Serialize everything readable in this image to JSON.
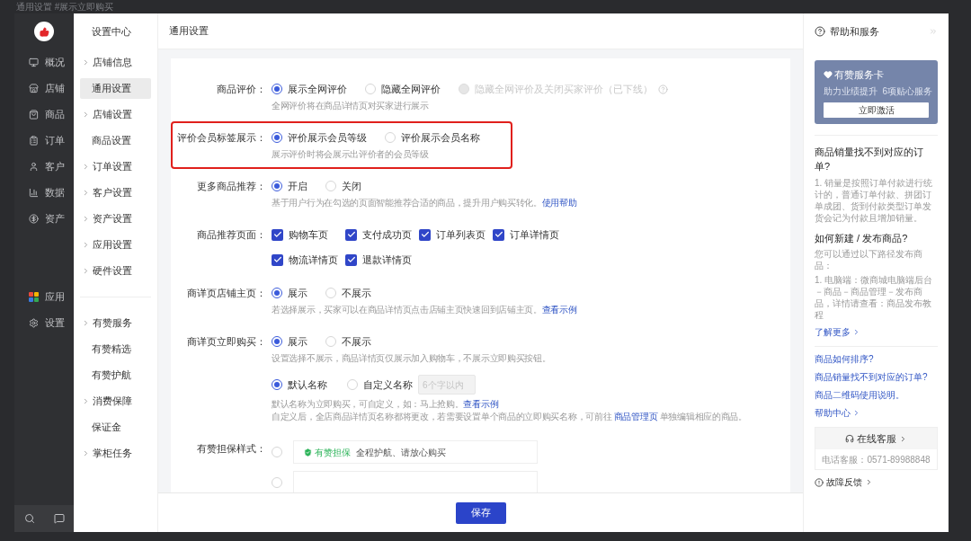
{
  "caption": "通用设置 #展示立即购买",
  "nav": [
    {
      "label": "概况"
    },
    {
      "label": "店铺"
    },
    {
      "label": "商品"
    },
    {
      "label": "订单"
    },
    {
      "label": "客户"
    },
    {
      "label": "数据"
    },
    {
      "label": "资产"
    }
  ],
  "nav_extra": [
    {
      "label": "应用"
    },
    {
      "label": "设置"
    }
  ],
  "subnav": {
    "title": "设置中心",
    "sections": [
      [
        {
          "label": "店铺信息",
          "kind": "folder",
          "selected": false
        },
        {
          "label": "通用设置",
          "kind": "page",
          "selected": true
        },
        {
          "label": "店铺设置",
          "kind": "folder",
          "selected": false
        },
        {
          "label": "商品设置",
          "kind": "page",
          "selected": false
        },
        {
          "label": "订单设置",
          "kind": "folder",
          "selected": false
        },
        {
          "label": "客户设置",
          "kind": "folder",
          "selected": false
        },
        {
          "label": "资产设置",
          "kind": "folder",
          "selected": false
        },
        {
          "label": "应用设置",
          "kind": "folder",
          "selected": false
        },
        {
          "label": "硬件设置",
          "kind": "folder",
          "selected": false
        }
      ],
      [
        {
          "label": "有赞服务",
          "kind": "folder",
          "selected": false
        },
        {
          "label": "有赞精选",
          "kind": "page",
          "selected": false
        },
        {
          "label": "有赞护航",
          "kind": "page",
          "selected": false
        },
        {
          "label": "消费保障",
          "kind": "folder",
          "selected": false
        },
        {
          "label": "保证金",
          "kind": "page",
          "selected": false
        },
        {
          "label": "掌柜任务",
          "kind": "folder",
          "selected": false
        }
      ]
    ]
  },
  "header": {
    "title": "通用设置"
  },
  "form": [
    {
      "label": "商品评价：",
      "kind": "radio",
      "highlighted": false,
      "options": [
        {
          "label": "展示全网评价",
          "selected": true,
          "disabled": false
        },
        {
          "label": "隐藏全网评价",
          "selected": false,
          "disabled": false
        },
        {
          "label": "隐藏全网评价及关闭买家评价（已下线）",
          "selected": false,
          "disabled": true
        }
      ],
      "hint": [
        {
          "text": "全网评价将在商品详情页对买家进行展示",
          "link": false
        }
      ]
    },
    {
      "label": "评价会员标签展示：",
      "kind": "radio",
      "highlighted": true,
      "options": [
        {
          "label": "评价展示会员等级",
          "selected": true,
          "disabled": false
        },
        {
          "label": "评价展示会员名称",
          "selected": false,
          "disabled": false
        }
      ],
      "hint": [
        {
          "text": "展示评价时将会展示出评价者的会员等级",
          "link": false
        }
      ]
    },
    {
      "label": "更多商品推荐：",
      "kind": "radio",
      "highlighted": false,
      "options": [
        {
          "label": "开启",
          "selected": true,
          "disabled": false
        },
        {
          "label": "关闭",
          "selected": false,
          "disabled": false
        }
      ],
      "hint": [
        {
          "text": "基于用户行为在勾选的页面智能推荐合适的商品，提升用户购买转化。",
          "link": false
        },
        {
          "text": "使用帮助",
          "link": true
        }
      ]
    },
    {
      "label": "商品推荐页面：",
      "kind": "checkbox",
      "highlighted": false,
      "options": [
        {
          "label": "购物车页",
          "checked": true
        },
        {
          "label": "支付成功页",
          "checked": true
        },
        {
          "label": "订单列表页",
          "checked": true
        },
        {
          "label": "订单详情页",
          "checked": true
        },
        {
          "label": "物流详情页",
          "checked": true
        },
        {
          "label": "退款详情页",
          "checked": true
        }
      ]
    },
    {
      "label": "商详页店铺主页：",
      "kind": "radio",
      "highlighted": false,
      "options": [
        {
          "label": "展示",
          "selected": true,
          "disabled": false
        },
        {
          "label": "不展示",
          "selected": false,
          "disabled": false
        }
      ],
      "hint": [
        {
          "text": "若选择展示，买家可以在商品详情页点击店铺主页快速回到店铺主页。",
          "link": false
        },
        {
          "text": "查看示例",
          "link": true
        }
      ]
    },
    {
      "label": "商详页立即购买：",
      "kind": "radio",
      "highlighted": false,
      "options": [
        {
          "label": "展示",
          "selected": true,
          "disabled": false
        },
        {
          "label": "不展示",
          "selected": false,
          "disabled": false
        }
      ],
      "hint": [
        {
          "text": "设置选择不展示，商品详情页仅展示加入购物车，不展示立即购买按钮。",
          "link": false
        }
      ],
      "sub": {
        "options": [
          {
            "label": "默认名称",
            "selected": true
          },
          {
            "label": "自定义名称",
            "selected": false
          }
        ],
        "placeholder": "6个字以内",
        "notes": [
          [
            {
              "text": "默认名称为立即购买，可自定义，如：马上抢购。",
              "link": false
            },
            {
              "text": "查看示例",
              "link": true
            }
          ],
          [
            {
              "text": "自定义后，全店商品详情页名称都将更改，若需要设置单个商品的立即购买名称，可前往 ",
              "link": false
            },
            {
              "text": "商品管理页",
              "link": true
            },
            {
              "text": " 单独编辑相应的商品。",
              "link": false
            }
          ]
        ]
      }
    },
    {
      "label": "有赞担保样式：",
      "kind": "badge",
      "highlighted": false,
      "options": [
        {
          "badge": "有赞担保",
          "text": "全程护航、请放心购买",
          "selected": false
        },
        {
          "selected": false
        }
      ]
    }
  ],
  "footer": {
    "button": "保存"
  },
  "help": {
    "title": "帮助和服务",
    "card": {
      "title": "有赞服务卡",
      "subtitle": "助力业绩提升  6项贴心服务",
      "button": "立即激活"
    },
    "faqs": [
      {
        "title": "商品销量找不到对应的订单?",
        "body": [
          "1. 销量是按照订单付款进行统计的，普通订单付款、拼团订单成团、货到付款类型订单发货会记为付款且增加销量。"
        ]
      },
      {
        "title": "如何新建 / 发布商品?",
        "body": [
          "您可以通过以下路径发布商品：",
          "1. 电脑端：微商城电脑端后台－商品－商品管理－发布商品，详情请查看：商品发布教程"
        ],
        "more": "了解更多"
      }
    ],
    "links": [
      "商品如何排序?",
      "商品销量找不到对应的订单?",
      "商品二维码使用说明。"
    ],
    "center": "帮助中心",
    "service": {
      "title": "在线客服",
      "phone": "电话客服：0571-89988848"
    },
    "feedback": "故障反馈"
  }
}
